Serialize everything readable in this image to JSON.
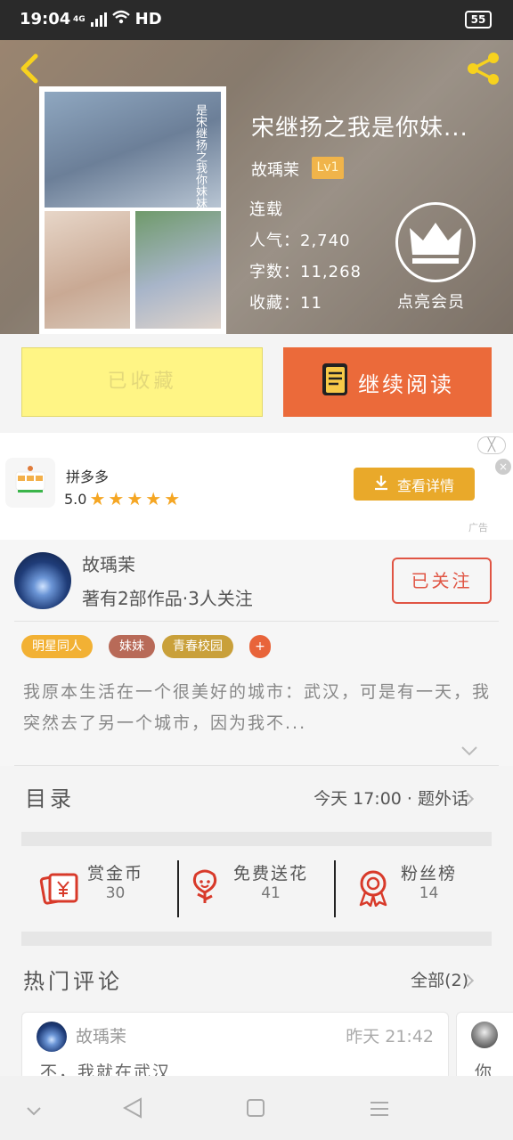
{
  "status": {
    "time": "19:04",
    "network": "HD",
    "cellular": "4G",
    "battery": "55"
  },
  "book": {
    "title": "宋继扬之我是你妹...",
    "cover_text": "是宋继扬之我你妹妹？",
    "author": "故瑀茉",
    "level": "Lv1",
    "state": "连载",
    "popularity": "人气：2,740",
    "word_count": "字数：11,268",
    "favorites": "收藏：11",
    "vip_label": "点亮会员"
  },
  "actions": {
    "favorited": "已收藏",
    "continue": "继续阅读"
  },
  "ad": {
    "app_name": "拼多多",
    "rating": "5.0",
    "stars": [
      "★",
      "★",
      "★",
      "★",
      "★"
    ],
    "button": "查看详情",
    "close": "╳",
    "x": "×",
    "tag": "广告"
  },
  "author_section": {
    "name": "故瑀茉",
    "info": "著有2部作品·3人关注",
    "follow": "已关注",
    "tags": [
      {
        "label": "明星同人",
        "color": "#f2b134"
      },
      {
        "label": "妹妹",
        "color": "#b86a58"
      },
      {
        "label": "青春校园",
        "color": "#c9a03a"
      },
      {
        "label": "+",
        "color": "#e8643a"
      }
    ],
    "synopsis": "我原本生活在一个很美好的城市：武汉，可是有一天，我突然去了另一个城市，因为我不..."
  },
  "toc": {
    "label": "目录",
    "latest": "今天 17:00 · 题外话"
  },
  "rewards": {
    "coin": {
      "label": "赏金币",
      "count": "30"
    },
    "flower": {
      "label": "免费送花",
      "count": "41"
    },
    "fans": {
      "label": "粉丝榜",
      "count": "14"
    }
  },
  "comments": {
    "label": "热门评论",
    "all": "全部(2)",
    "items": [
      {
        "user": "故瑀茉",
        "time": "昨天 21:42",
        "text": "不，我就在武汉"
      },
      {
        "user": "",
        "time": "",
        "text": "你"
      }
    ]
  },
  "colors": {
    "accent": "#eb6a3a",
    "fav": "#fff585",
    "follow": "#e05544",
    "ad_button": "#e9a92a"
  }
}
